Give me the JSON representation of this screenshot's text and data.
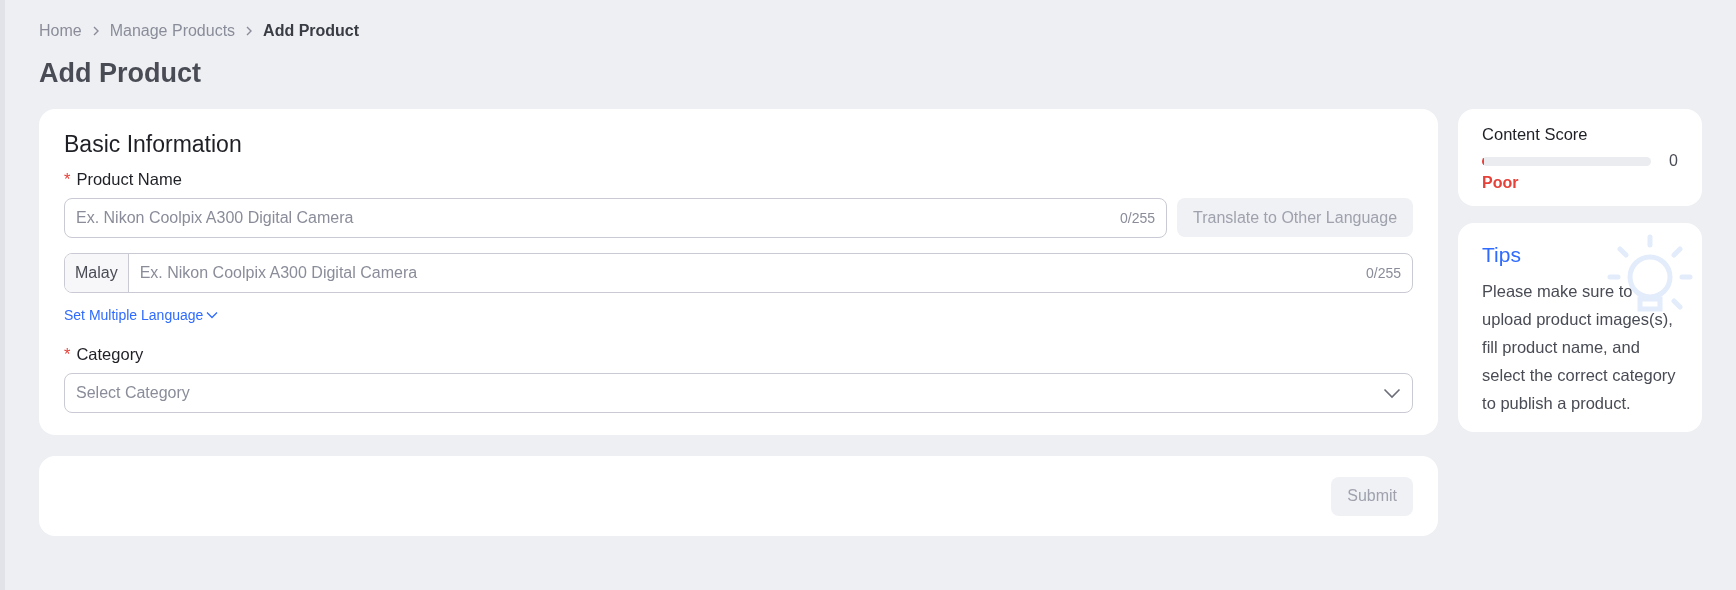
{
  "breadcrumb": [
    {
      "label": "Home",
      "current": false
    },
    {
      "label": "Manage Products",
      "current": false
    },
    {
      "label": "Add Product",
      "current": true
    }
  ],
  "page_title": "Add Product",
  "basic_information": {
    "title": "Basic Information",
    "product_name": {
      "label": "Product Name",
      "required_mark": "*",
      "placeholder": "Ex. Nikon Coolpix A300 Digital Camera",
      "counter": "0/255",
      "translate_button": {
        "label": "Translate to Other Language",
        "disabled": true
      }
    },
    "language_field": {
      "language": "Malay",
      "placeholder": "Ex. Nikon Coolpix A300 Digital Camera",
      "counter": "0/255"
    },
    "set_multiple_language": "Set Multiple Language",
    "category": {
      "label": "Category",
      "required_mark": "*",
      "placeholder": "Select Category"
    }
  },
  "submit_button": {
    "label": "Submit",
    "disabled": true
  },
  "content_score": {
    "title": "Content Score",
    "level": 0.01,
    "value": "0",
    "rating": "Poor"
  },
  "tips": {
    "title": "Tips",
    "text": "Please make sure to upload product images(s), fill product name, and select the correct category to publish a product."
  }
}
